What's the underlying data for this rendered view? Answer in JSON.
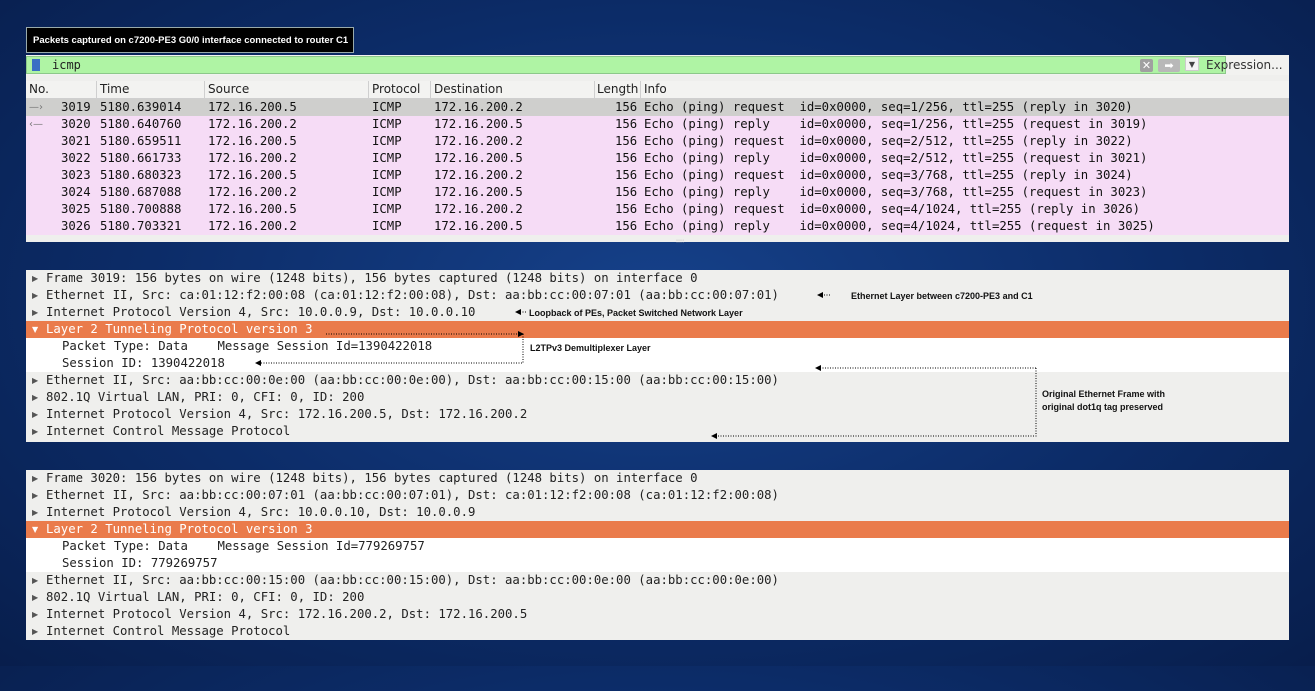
{
  "caption": "Packets captured on c7200-PE3 G0/0 interface connected to router C1",
  "filter": {
    "value": "icmp",
    "expression_label": "Expression..."
  },
  "columns": [
    "No.",
    "Time",
    "Source",
    "Protocol",
    "Destination",
    "Length",
    "Info"
  ],
  "packets": [
    {
      "no": "3019",
      "time": "5180.639014",
      "source": "172.16.200.5",
      "protocol": "ICMP",
      "destination": "172.16.200.2",
      "length": "156",
      "info": "Echo (ping) request  id=0x0000, seq=1/256, ttl=255 (reply in 3020)"
    },
    {
      "no": "3020",
      "time": "5180.640760",
      "source": "172.16.200.2",
      "protocol": "ICMP",
      "destination": "172.16.200.5",
      "length": "156",
      "info": "Echo (ping) reply    id=0x0000, seq=1/256, ttl=255 (request in 3019)"
    },
    {
      "no": "3021",
      "time": "5180.659511",
      "source": "172.16.200.5",
      "protocol": "ICMP",
      "destination": "172.16.200.2",
      "length": "156",
      "info": "Echo (ping) request  id=0x0000, seq=2/512, ttl=255 (reply in 3022)"
    },
    {
      "no": "3022",
      "time": "5180.661733",
      "source": "172.16.200.2",
      "protocol": "ICMP",
      "destination": "172.16.200.5",
      "length": "156",
      "info": "Echo (ping) reply    id=0x0000, seq=2/512, ttl=255 (request in 3021)"
    },
    {
      "no": "3023",
      "time": "5180.680323",
      "source": "172.16.200.5",
      "protocol": "ICMP",
      "destination": "172.16.200.2",
      "length": "156",
      "info": "Echo (ping) request  id=0x0000, seq=3/768, ttl=255 (reply in 3024)"
    },
    {
      "no": "3024",
      "time": "5180.687088",
      "source": "172.16.200.2",
      "protocol": "ICMP",
      "destination": "172.16.200.5",
      "length": "156",
      "info": "Echo (ping) reply    id=0x0000, seq=3/768, ttl=255 (request in 3023)"
    },
    {
      "no": "3025",
      "time": "5180.700888",
      "source": "172.16.200.5",
      "protocol": "ICMP",
      "destination": "172.16.200.2",
      "length": "156",
      "info": "Echo (ping) request  id=0x0000, seq=4/1024, ttl=255 (reply in 3026)"
    },
    {
      "no": "3026",
      "time": "5180.703321",
      "source": "172.16.200.2",
      "protocol": "ICMP",
      "destination": "172.16.200.5",
      "length": "156",
      "info": "Echo (ping) reply    id=0x0000, seq=4/1024, ttl=255 (request in 3025)"
    }
  ],
  "details_3019": [
    "Frame 3019: 156 bytes on wire (1248 bits), 156 bytes captured (1248 bits) on interface 0",
    "Ethernet II, Src: ca:01:12:f2:00:08 (ca:01:12:f2:00:08), Dst: aa:bb:cc:00:07:01 (aa:bb:cc:00:07:01)",
    "Internet Protocol Version 4, Src: 10.0.0.9, Dst: 10.0.0.10",
    "Layer 2 Tunneling Protocol version 3",
    "Packet Type: Data    Message Session Id=1390422018",
    "Session ID: 1390422018",
    "Ethernet II, Src: aa:bb:cc:00:0e:00 (aa:bb:cc:00:0e:00), Dst: aa:bb:cc:00:15:00 (aa:bb:cc:00:15:00)",
    "802.1Q Virtual LAN, PRI: 0, CFI: 0, ID: 200",
    "Internet Protocol Version 4, Src: 172.16.200.5, Dst: 172.16.200.2",
    "Internet Control Message Protocol"
  ],
  "details_3020": [
    "Frame 3020: 156 bytes on wire (1248 bits), 156 bytes captured (1248 bits) on interface 0",
    "Ethernet II, Src: aa:bb:cc:00:07:01 (aa:bb:cc:00:07:01), Dst: ca:01:12:f2:00:08 (ca:01:12:f2:00:08)",
    "Internet Protocol Version 4, Src: 10.0.0.10, Dst: 10.0.0.9",
    "Layer 2 Tunneling Protocol version 3",
    "Packet Type: Data    Message Session Id=779269757",
    "Session ID: 779269757",
    "Ethernet II, Src: aa:bb:cc:00:15:00 (aa:bb:cc:00:15:00), Dst: aa:bb:cc:00:0e:00 (aa:bb:cc:00:0e:00)",
    "802.1Q Virtual LAN, PRI: 0, CFI: 0, ID: 200",
    "Internet Protocol Version 4, Src: 172.16.200.2, Dst: 172.16.200.5",
    "Internet Control Message Protocol"
  ],
  "annotations": {
    "ethernet_layer": "Ethernet Layer between c7200-PE3 and C1",
    "loopback": "Loopback of PEs, Packet Switched Network Layer",
    "l2tpv3": "L2TPv3 Demultiplexer Layer",
    "original_frame_1": "Original Ethernet Frame with",
    "original_frame_2": "original dot1q tag preserved"
  },
  "colors": {
    "highlight": "#ea7b4b",
    "packet_row": "#f6dcf6",
    "selected_row": "#cfcfcd",
    "filter_bg": "#aff4a4"
  }
}
